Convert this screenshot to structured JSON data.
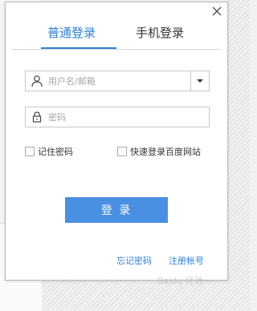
{
  "dialog": {
    "tabs": [
      {
        "label": "普通登录",
        "active": true
      },
      {
        "label": "手机登录",
        "active": false
      }
    ],
    "username": {
      "placeholder": "用户名/邮箱",
      "value": ""
    },
    "password": {
      "placeholder": "密码",
      "value": ""
    },
    "remember_label": "记住密码",
    "quick_login_label": "快速登录百度网站",
    "login_label": "登 录",
    "forgot_label": "忘记密码",
    "register_label": "注册帐号"
  },
  "watermark": {
    "text": "Baidu 经验"
  },
  "colors": {
    "accent": "#2f80cf",
    "button": "#4a90e2",
    "border": "#c9c9c9"
  },
  "icons": {
    "close": "close-icon",
    "user": "user-icon",
    "lock": "lock-icon",
    "dropdown": "chevron-down-icon"
  }
}
